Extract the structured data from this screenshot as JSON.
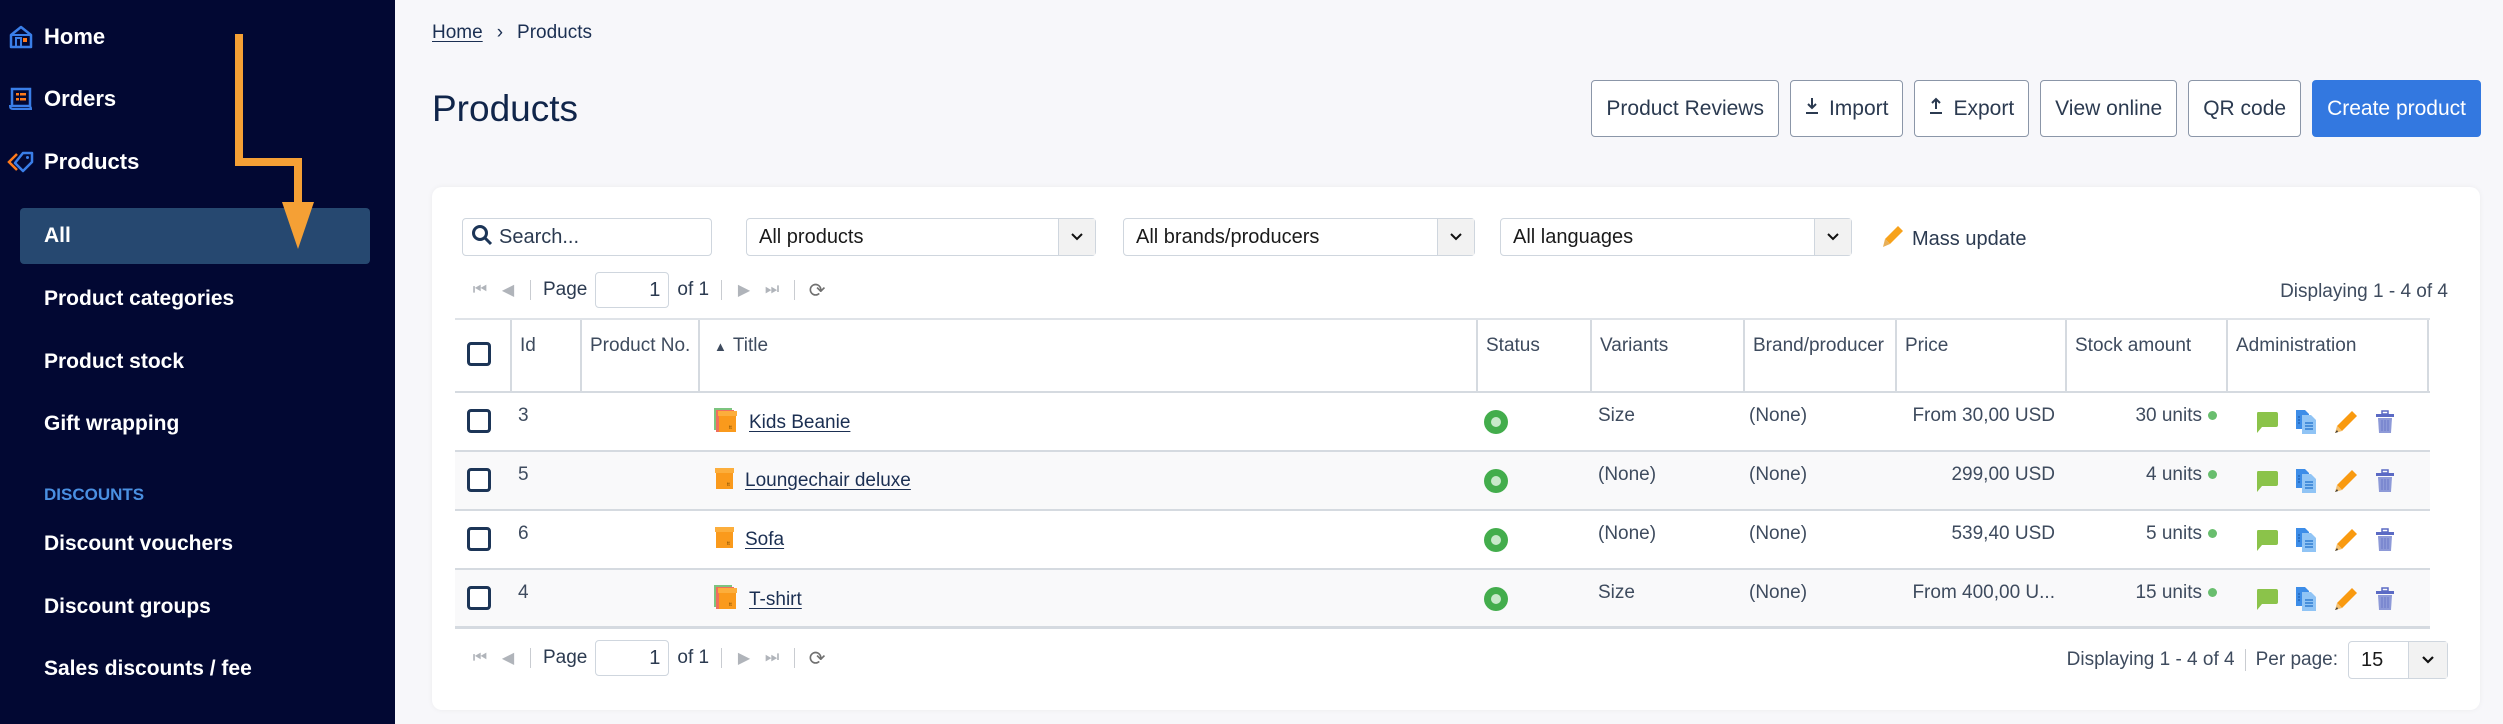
{
  "sidebar": {
    "top_items": [
      {
        "label": "Home",
        "icon": "home-icon"
      },
      {
        "label": "Orders",
        "icon": "orders-icon"
      },
      {
        "label": "Products",
        "icon": "tag-icon"
      }
    ],
    "product_sub_items": [
      {
        "label": "All",
        "selected": true
      },
      {
        "label": "Product categories"
      },
      {
        "label": "Product stock"
      },
      {
        "label": "Gift wrapping"
      }
    ],
    "section_discounts": "DISCOUNTS",
    "discount_items": [
      {
        "label": "Discount vouchers"
      },
      {
        "label": "Discount groups"
      },
      {
        "label": "Sales discounts / fee"
      }
    ],
    "colors": {
      "background": "#020833",
      "selected": "#264870",
      "section": "#4a90e2",
      "annotation_arrow": "#f5a035"
    }
  },
  "breadcrumb": {
    "home": "Home",
    "separator": "›",
    "current": "Products"
  },
  "page_title": "Products",
  "toolbar": {
    "product_reviews": "Product Reviews",
    "import": "Import",
    "export": "Export",
    "view_online": "View online",
    "qr_code": "QR code",
    "create_product": "Create product",
    "accent": "#3378e0"
  },
  "filters": {
    "search_placeholder": "Search...",
    "product_filter": "All products",
    "brand_filter": "All brands/producers",
    "language_filter": "All languages",
    "mass_update": "Mass update"
  },
  "pager_top": {
    "page_label": "Page",
    "page_value": "1",
    "of_label": "of 1",
    "displaying": "Displaying 1 - 4 of 4"
  },
  "table": {
    "columns": [
      "Id",
      "Product No.",
      "Title",
      "Status",
      "Variants",
      "Brand/producer",
      "Price",
      "Stock amount",
      "Administration"
    ],
    "sort_column": "Title",
    "sort_direction": "ascending",
    "rows": [
      {
        "id": "3",
        "product_no": "",
        "title": "Kids Beanie",
        "has_variants": true,
        "status": "active",
        "variants": "Size",
        "brand": "(None)",
        "price": "From 30,00 USD",
        "stock": "30 units"
      },
      {
        "id": "5",
        "product_no": "",
        "title": "Loungechair deluxe",
        "has_variants": false,
        "status": "active",
        "variants": "(None)",
        "brand": "(None)",
        "price": "299,00 USD",
        "stock": "4 units"
      },
      {
        "id": "6",
        "product_no": "",
        "title": "Sofa",
        "has_variants": false,
        "status": "active",
        "variants": "(None)",
        "brand": "(None)",
        "price": "539,40 USD",
        "stock": "5 units"
      },
      {
        "id": "4",
        "product_no": "",
        "title": "T-shirt",
        "has_variants": true,
        "status": "active",
        "variants": "Size",
        "brand": "(None)",
        "price": "From 400,00 U...",
        "stock": "15 units"
      }
    ]
  },
  "pager_bottom": {
    "page_label": "Page",
    "page_value": "1",
    "of_label": "of 1",
    "displaying": "Displaying 1 - 4 of 4",
    "per_page_label": "Per page:",
    "per_page_value": "15"
  }
}
